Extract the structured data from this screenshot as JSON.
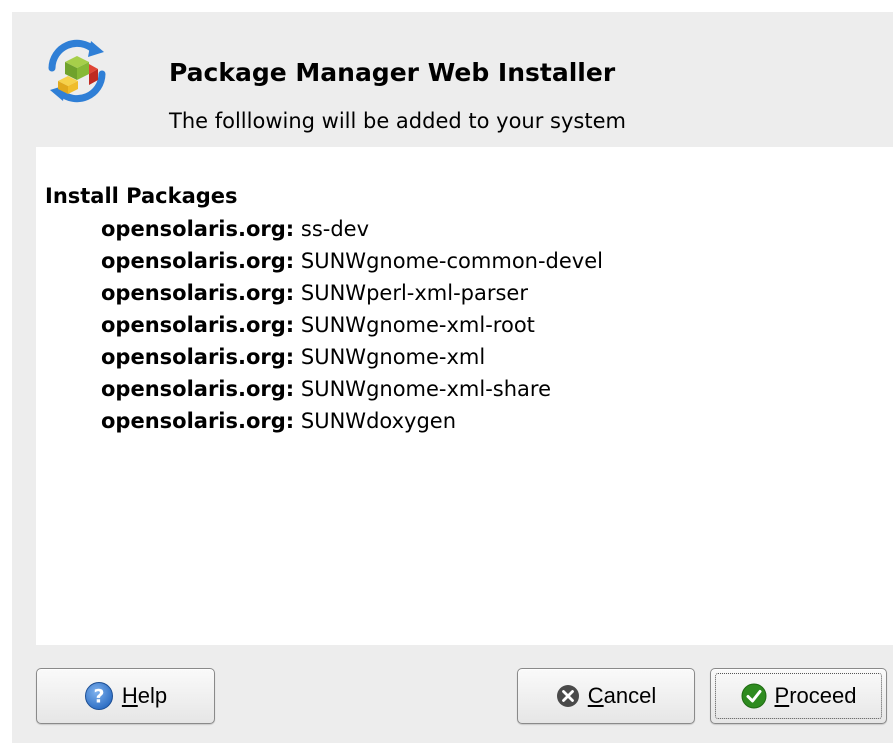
{
  "dialog": {
    "title": "Package Manager Web Installer",
    "subtitle": "The folllowing will be added to your system",
    "app_icon": "package-cubes-refresh-icon"
  },
  "content": {
    "section_heading": "Install Packages",
    "packages": [
      {
        "origin": "opensolaris.org:",
        "name": "ss-dev"
      },
      {
        "origin": "opensolaris.org:",
        "name": "SUNWgnome-common-devel"
      },
      {
        "origin": "opensolaris.org:",
        "name": "SUNWperl-xml-parser"
      },
      {
        "origin": "opensolaris.org:",
        "name": "SUNWgnome-xml-root"
      },
      {
        "origin": "opensolaris.org:",
        "name": "SUNWgnome-xml"
      },
      {
        "origin": "opensolaris.org:",
        "name": "SUNWgnome-xml-share"
      },
      {
        "origin": "opensolaris.org:",
        "name": "SUNWdoxygen"
      }
    ]
  },
  "buttons": {
    "help": {
      "mnemonic": "H",
      "rest": "elp",
      "icon": "help-icon"
    },
    "cancel": {
      "mnemonic": "C",
      "rest": "ancel",
      "icon": "cancel-icon"
    },
    "proceed": {
      "mnemonic": "P",
      "rest": "roceed",
      "icon": "check-icon"
    }
  },
  "colors": {
    "dialog_background": "#ededed",
    "content_background": "#ffffff",
    "help_icon_blue": "#2f6fc4",
    "cancel_icon_gray": "#4a4a4a",
    "proceed_icon_green": "#2e8b1f"
  }
}
